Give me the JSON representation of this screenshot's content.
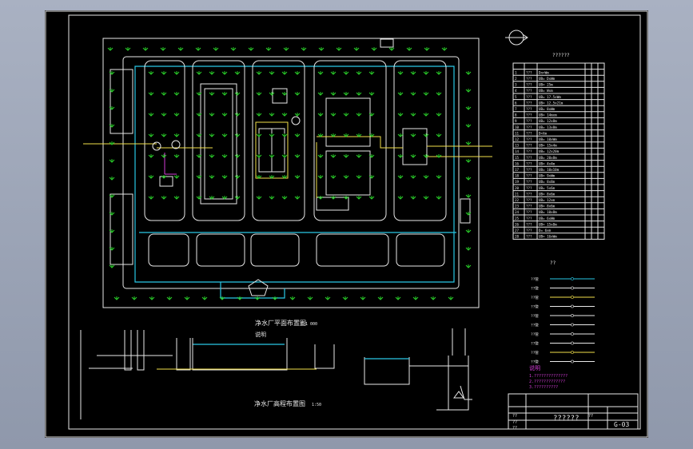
{
  "legend_title": "??????",
  "legend_label": "??",
  "title_block": {
    "project": "??????",
    "code": "G-03",
    "sheet": "??",
    "row1": "??",
    "row2": "??",
    "row3": "??"
  },
  "plan_title": "净水厂平面布置图",
  "plan_scale": "1:1 000",
  "plan_note": "说明",
  "profile_title": "净水厂高程布置图",
  "profile_scale": "1:50",
  "notes": [
    "1.??????????????",
    "2.?????????????",
    "3.??????????"
  ],
  "colors": {
    "white": "#e8e8e8",
    "cyan": "#29c8e6",
    "yellow": "#f2e04a",
    "magenta": "#d23cd6",
    "green": "#2ad12a"
  },
  "table_rows": [
    [
      "1",
      "???",
      "Dn=Wm"
    ],
    [
      "2",
      "???",
      "UB= DxWm"
    ],
    [
      "3",
      "???",
      "UB= 25m"
    ],
    [
      "4",
      "???",
      "UB= Wxm"
    ],
    [
      "5",
      "???",
      "UB= 17.5xWm"
    ],
    [
      "6",
      "???",
      "UB= 12.5x21m"
    ],
    [
      "7",
      "???",
      "UB= 8xWm"
    ],
    [
      "8",
      "???",
      "UB= 14mxm"
    ],
    [
      "9",
      "???",
      "UB= 12x8m"
    ],
    [
      "10",
      "???",
      "UB= 13x8m"
    ],
    [
      "11",
      "???",
      "D=Xm"
    ],
    [
      "12",
      "???",
      "UB= 10xWm"
    ],
    [
      "13",
      "???",
      "UB= 15x4m"
    ],
    [
      "14",
      "???",
      "UB= 12x20m"
    ],
    [
      "15",
      "???",
      "UB= 20x8m"
    ],
    [
      "16",
      "???",
      "UB= 4x4m"
    ],
    [
      "17",
      "???",
      "UB= 10x10m"
    ],
    [
      "18",
      "???",
      "UB= 9xWm"
    ],
    [
      "19",
      "???",
      "UB= 8x8m"
    ],
    [
      "20",
      "???",
      "UB= 5x6m"
    ],
    [
      "21",
      "???",
      "UB= 8x6m"
    ],
    [
      "22",
      "???",
      "UB= 12xm"
    ],
    [
      "23",
      "???",
      "UB= 8x6m"
    ],
    [
      "24",
      "???",
      "UB= 10x8m"
    ],
    [
      "25",
      "???",
      "UB= 6xWm"
    ],
    [
      "26",
      "???",
      "UB= 15x8m"
    ],
    [
      "27",
      "???",
      "D= 6xm"
    ],
    [
      "28",
      "???",
      "UB= 16xWm"
    ]
  ],
  "pipe_legend": [
    {
      "name": "??管",
      "color": "#29c8e6"
    },
    {
      "name": "??管",
      "color": "#e8e8e8"
    },
    {
      "name": "??管",
      "color": "#f2e04a"
    },
    {
      "name": "??管",
      "color": "#e8e8e8"
    },
    {
      "name": "??管",
      "color": "#e8e8e8"
    },
    {
      "name": "??管",
      "color": "#e8e8e8"
    },
    {
      "name": "??管",
      "color": "#e8e8e8"
    },
    {
      "name": "??管",
      "color": "#e8e8e8"
    },
    {
      "name": "??管",
      "color": "#f2e04a"
    },
    {
      "name": "??管",
      "color": "#e8e8e8"
    }
  ]
}
